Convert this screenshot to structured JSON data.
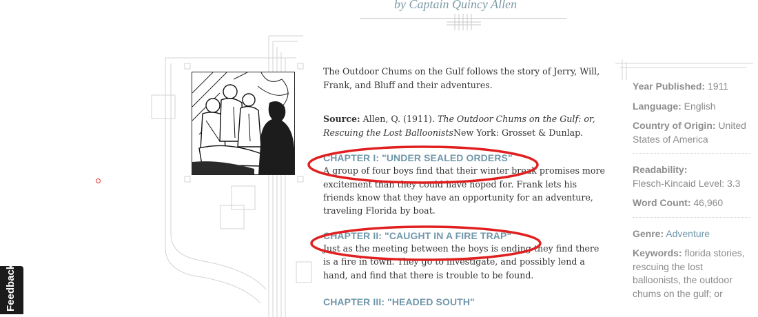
{
  "byline": "by Captain Quincy Allen",
  "summary": "The Outdoor Chums on the Gulf follows the story of Jerry, Will, Frank, and Bluff and their adventures.",
  "source": {
    "label": "Source:",
    "text_before": " Allen, Q. (1911). ",
    "title": "The Outdoor Chums on the Gulf: or, Rescuing the Lost Balloonists",
    "text_after": "New York: Grosset & Dunlap."
  },
  "chapters": [
    {
      "title": "CHAPTER I: \"UNDER SEALED ORDERS\"",
      "description": "A group of four boys find that their winter break promises more excitement than they could have hoped for. Frank lets his friends know that they have an opportunity for an adventure, traveling Florida by boat."
    },
    {
      "title": "CHAPTER II: \"CAUGHT IN A FIRE TRAP\"",
      "description": "Just as the meeting between the boys is ending they find there is a fire in town. They go to investigate, and possibly lend a hand, and find that there is trouble to be found."
    },
    {
      "title": "CHAPTER III: \"HEADED SOUTH\"",
      "description": ""
    }
  ],
  "sidebar": {
    "year_label": "Year Published:",
    "year_value": "1911",
    "language_label": "Language:",
    "language_value": "English",
    "country_label": "Country of Origin:",
    "country_value": "United States of America",
    "readability_label": "Readability:",
    "readability_value": "Flesch-Kincaid Level: 3.3",
    "wordcount_label": "Word Count:",
    "wordcount_value": "46,960",
    "genre_label": "Genre:",
    "genre_value": "Adventure",
    "keywords_label": "Keywords:",
    "keywords_value": "florida stories, rescuing the lost balloonists, the outdoor chums on the gulf; or"
  },
  "feedback_tab": "Feedback",
  "colors": {
    "accent": "#6f97aa",
    "annotation": "#e02020",
    "feedback_bg": "#1b1b1b"
  }
}
